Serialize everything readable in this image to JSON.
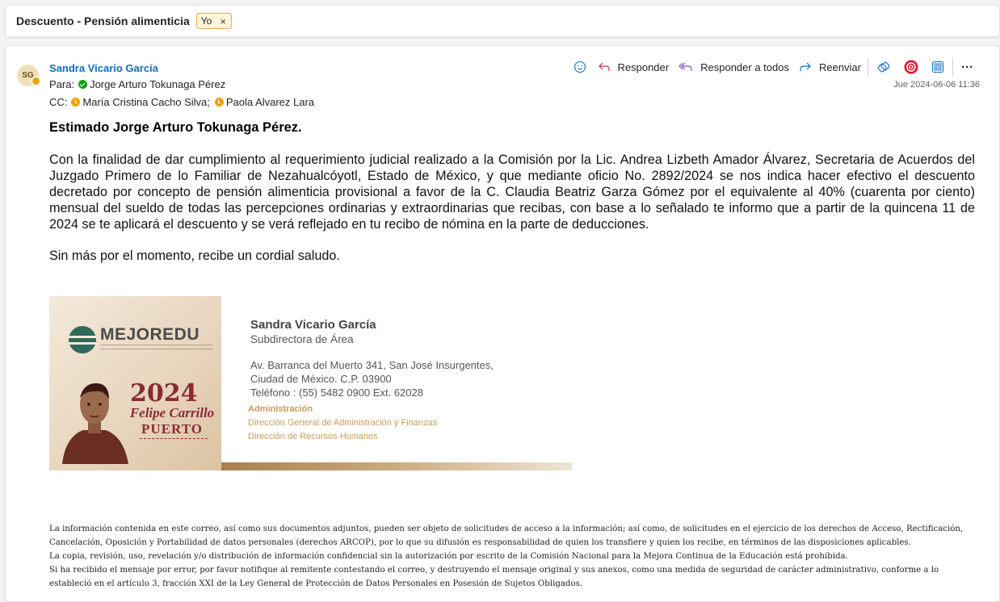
{
  "subject": "Descuento - Pensión alimenticia",
  "tag": {
    "label": "Yo",
    "remove": "×"
  },
  "sender": {
    "initials": "SG",
    "name": "Sandra Vicario García"
  },
  "to": {
    "label": "Para:",
    "name": "Jorge Arturo Tokunaga Pérez"
  },
  "cc": {
    "label": "CC:",
    "names": [
      "María Cristina Cacho Silva;",
      "Paola Alvarez Lara"
    ]
  },
  "actions": {
    "reply": "Responder",
    "reply_all": "Responder a todos",
    "forward": "Reenviar",
    "more": "···"
  },
  "timestamp": "Jue 2024-06-06 11:36",
  "body": {
    "greeting": "Estimado Jorge Arturo Tokunaga Pérez.",
    "paragraph": "Con la finalidad de dar cumplimiento al requerimiento judicial realizado a la Comisión por la Lic. Andrea Lizbeth Amador Álvarez, Secretaria de Acuerdos del Juzgado Primero de lo Familiar de Nezahualcóyotl, Estado de México, y que mediante oficio No. 2892/2024 se nos indica hacer efectivo el descuento decretado por concepto de pensión alimenticia provisional a favor de la C. Claudia Beatriz Garza Gómez por el equivalente al 40% (cuarenta por ciento) mensual del sueldo de todas las percepciones ordinarias y extraordinarias que recibas, con base a lo señalado te informo que a partir de la quincena 11 de 2024 se te aplicará el descuento y se verá reflejado en tu recibo de nómina en la parte de deducciones.",
    "closing": "Sin más por el momento, recibe un cordial saludo."
  },
  "signature": {
    "logo_text": "MEJOREDU",
    "year": "2024",
    "honoree_line1": "Felipe Carrillo",
    "honoree_line2": "PUERTO",
    "name": "Sandra Vicario García",
    "role": "Subdirectora de Área",
    "address_line1": "Av. Barranca del Muerto 341, San José Insurgentes,",
    "address_line2": "Ciudad de México. C.P. 03900",
    "phone": "Teléfono : (55) 5482 0900 Ext. 62028",
    "area": "Administración",
    "direction1": "Dirección General de Administración y Finanzas",
    "direction2": "Dirección de Recursos Humanos"
  },
  "legal": [
    "La información contenida en este correo, así como sus documentos adjuntos, pueden ser objeto de solicitudes de acceso a la información; así como, de solicitudes en el ejercicio de los derechos de Acceso, Rectificación, Cancelación, Oposición y Portabilidad de datos personales (derechos ARCOP), por lo que su difusión es responsabilidad de quien los transfiere y quien los recibe, en términos de las disposiciones aplicables.",
    "La copia, revisión, uso, revelación y/o distribución de información confidencial sin la autorización por escrito de la Comisión Nacional para la Mejora Continua de la Educación está prohibida.",
    "Si ha recibido el mensaje por error, por favor notifique al remitente contestando el correo, y destruyendo el mensaje original y sus anexos, como una medida de seguridad de carácter administrativo, conforme a lo estableció en el artículo 3, fracción XXI de la Ley General de Protección de Datos Personales en Posesión de Sujetos Obligados."
  ]
}
